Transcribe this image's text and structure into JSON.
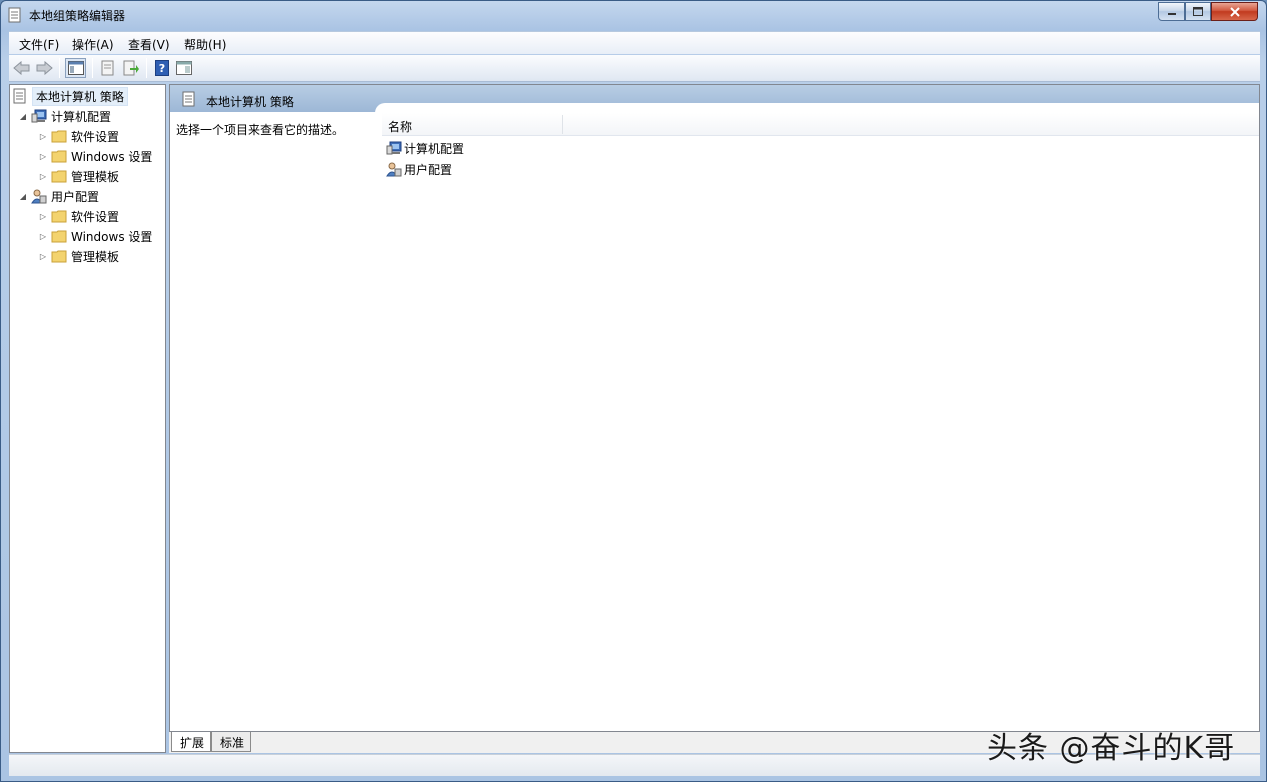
{
  "window": {
    "title": "本地组策略编辑器"
  },
  "menu": [
    {
      "label": "文件(F)"
    },
    {
      "label": "操作(A)"
    },
    {
      "label": "查看(V)"
    },
    {
      "label": "帮助(H)"
    }
  ],
  "tree": {
    "root": "本地计算机 策略",
    "items": [
      {
        "label": "计算机配置",
        "level": 1,
        "expanded": true,
        "icon": "computer-config-icon"
      },
      {
        "label": "软件设置",
        "level": 2,
        "icon": "folder-icon"
      },
      {
        "label": "Windows 设置",
        "level": 2,
        "icon": "folder-icon"
      },
      {
        "label": "管理模板",
        "level": 2,
        "icon": "folder-icon"
      },
      {
        "label": "用户配置",
        "level": 1,
        "expanded": true,
        "icon": "user-config-icon"
      },
      {
        "label": "软件设置",
        "level": 2,
        "icon": "folder-icon"
      },
      {
        "label": "Windows 设置",
        "level": 2,
        "icon": "folder-icon"
      },
      {
        "label": "管理模板",
        "level": 2,
        "icon": "folder-icon"
      }
    ]
  },
  "details": {
    "header_title": "本地计算机 策略",
    "description": "选择一个项目来查看它的描述。",
    "column_name": "名称",
    "rows": [
      {
        "label": "计算机配置",
        "icon": "computer-config-icon"
      },
      {
        "label": "用户配置",
        "icon": "user-config-icon"
      }
    ]
  },
  "tabs": [
    {
      "label": "扩展",
      "active": true
    },
    {
      "label": "标准",
      "active": false
    }
  ],
  "watermark": "头条 @奋斗的K哥",
  "colors": {
    "header_band": "#9db7d6",
    "selection": "#e3eef9",
    "folder": "#e8c15b"
  }
}
